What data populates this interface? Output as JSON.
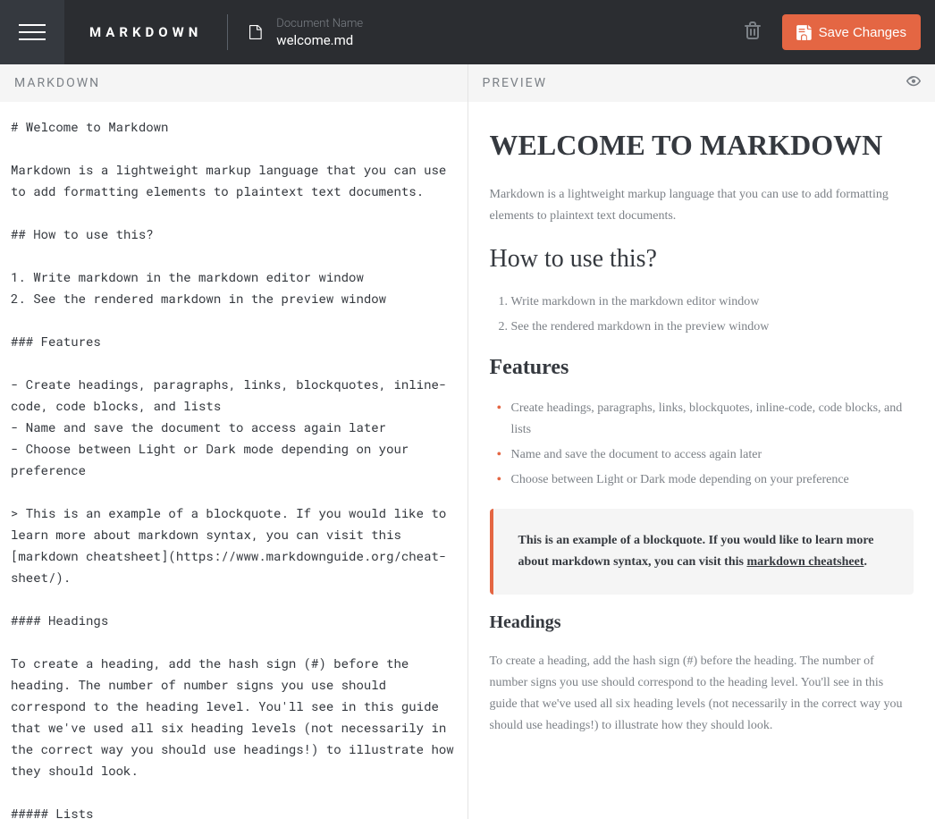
{
  "header": {
    "logo": "MARKDOWN",
    "doc_label": "Document Name",
    "doc_name": "welcome.md",
    "save_label": "Save Changes"
  },
  "panes": {
    "editor_title": "MARKDOWN",
    "preview_title": "PREVIEW"
  },
  "editor_content": "# Welcome to Markdown\n\nMarkdown is a lightweight markup language that you can use to add formatting elements to plaintext text documents.\n\n## How to use this?\n\n1. Write markdown in the markdown editor window\n2. See the rendered markdown in the preview window\n\n### Features\n\n- Create headings, paragraphs, links, blockquotes, inline-code, code blocks, and lists\n- Name and save the document to access again later\n- Choose between Light or Dark mode depending on your preference\n\n> This is an example of a blockquote. If you would like to learn more about markdown syntax, you can visit this [markdown cheatsheet](https://www.markdownguide.org/cheat-sheet/).\n\n#### Headings\n\nTo create a heading, add the hash sign (#) before the heading. The number of number signs you use should correspond to the heading level. You'll see in this guide that we've used all six heading levels (not necessarily in the correct way you should use headings!) to illustrate how they should look.\n\n##### Lists",
  "preview": {
    "h1": "WELCOME TO MARKDOWN",
    "p1": "Markdown is a lightweight markup language that you can use to add formatting elements to plaintext text documents.",
    "h2": "How to use this?",
    "ol": [
      "Write markdown in the markdown editor window",
      "See the rendered markdown in the preview window"
    ],
    "h3": "Features",
    "ul": [
      "Create headings, paragraphs, links, blockquotes, inline-code, code blocks, and lists",
      "Name and save the document to access again later",
      "Choose between Light or Dark mode depending on your preference"
    ],
    "blockquote_prefix": "This is an example of a blockquote. If you would like to learn more about markdown syntax, you can visit this ",
    "blockquote_link": "markdown cheatsheet",
    "blockquote_suffix": ".",
    "h4": "Headings",
    "p2": "To create a heading, add the hash sign (#) before the heading. The number of number signs you use should correspond to the heading level. You'll see in this guide that we've used all six heading levels (not necessarily in the correct way you should use headings!) to illustrate how they should look."
  }
}
